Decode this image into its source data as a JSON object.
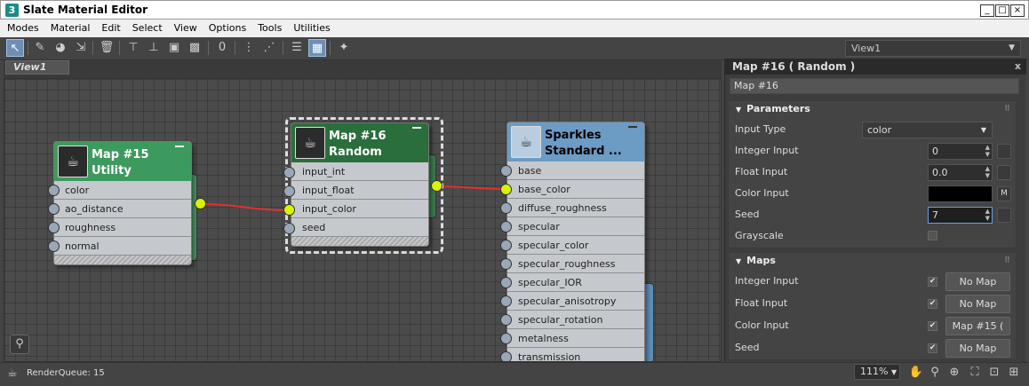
{
  "window": {
    "title": "Slate Material Editor",
    "app_icon": "3",
    "minimize": "_",
    "maximize": "□",
    "close": "×"
  },
  "menu": [
    "Modes",
    "Material",
    "Edit",
    "Select",
    "View",
    "Options",
    "Tools",
    "Utilities"
  ],
  "toolbar": {
    "view_select": "View1",
    "icons": [
      "select-arrow-icon",
      "eyedropper-icon",
      "pick-material-icon",
      "assign-material-icon",
      "delete-icon",
      "move-children-icon",
      "hide-unused-icon",
      "show-background-icon",
      "show-map-icon",
      "material-id-icon",
      "layout-all-icon",
      "layout-children-icon",
      "select-by-material-icon",
      "parameter-editor-icon",
      "node-display-icon"
    ]
  },
  "view": {
    "tab": "View1"
  },
  "nodes": {
    "utility": {
      "title_line1": "Map #15",
      "title_line2": "Utility",
      "slots": [
        "color",
        "ao_distance",
        "roughness",
        "normal"
      ]
    },
    "random": {
      "title_line1": "Map #16",
      "title_line2": "Random",
      "slots": [
        "input_int",
        "input_float",
        "input_color",
        "seed"
      ]
    },
    "sparkles": {
      "title_line1": "Sparkles",
      "title_line2": "Standard ...",
      "slots": [
        "base",
        "base_color",
        "diffuse_roughness",
        "specular",
        "specular_color",
        "specular_roughness",
        "specular_IOR",
        "specular_anisotropy",
        "specular_rotation",
        "metalness",
        "transmission"
      ]
    }
  },
  "status": {
    "render_queue": "RenderQueue: 15",
    "zoom": "111%"
  },
  "panel": {
    "header": "Map #16  ( Random )",
    "close": "x",
    "name_field": "Map #16",
    "parameters": {
      "title": "Parameters",
      "input_type_label": "Input Type",
      "input_type_value": "color",
      "integer_input_label": "Integer Input",
      "integer_input_value": "0",
      "float_input_label": "Float Input",
      "float_input_value": "0.0",
      "color_input_label": "Color Input",
      "color_input_value": "#000000",
      "color_map_button": "M",
      "seed_label": "Seed",
      "seed_value": "7",
      "grayscale_label": "Grayscale"
    },
    "maps": {
      "title": "Maps",
      "rows": [
        {
          "label": "Integer Input",
          "checked": "✔",
          "button": "No Map"
        },
        {
          "label": "Float Input",
          "checked": "✔",
          "button": "No Map"
        },
        {
          "label": "Color Input",
          "checked": "✔",
          "button": "Map #15  ("
        },
        {
          "label": "Seed",
          "checked": "✔",
          "button": "No Map"
        }
      ]
    }
  },
  "colors": {
    "utility_header": "#3d9a5e",
    "random_header": "#2a6e3c",
    "sparkles_header": "#6c9bc4",
    "wire": "#e0312f",
    "hot_pin": "#d8f200"
  }
}
